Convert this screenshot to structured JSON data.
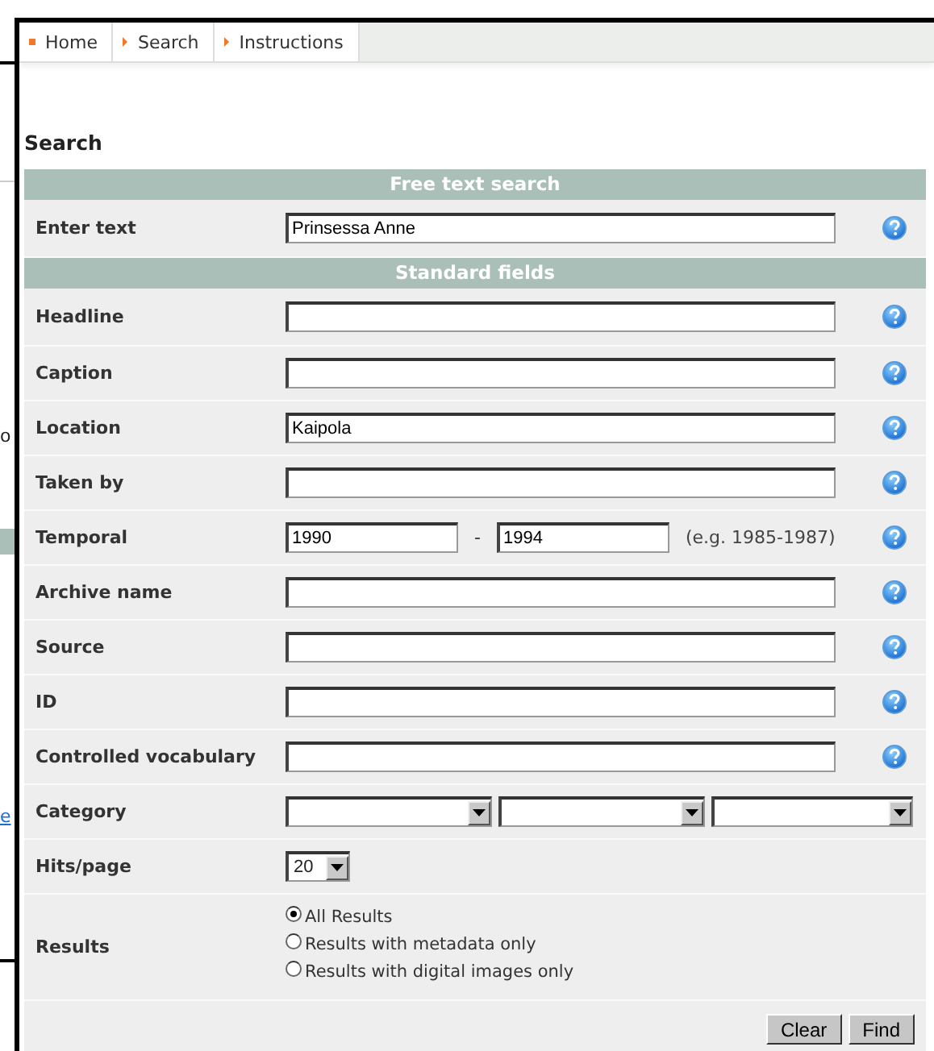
{
  "backdrop": {
    "fragment": "o",
    "link": "e"
  },
  "breadcrumb": [
    {
      "label": "Home",
      "kind": "home"
    },
    {
      "label": "Search",
      "kind": "step"
    },
    {
      "label": "Instructions",
      "kind": "step"
    }
  ],
  "title": "Search",
  "sections": [
    {
      "header": "Free text search",
      "rows": [
        {
          "label": "Enter text",
          "kind": "text",
          "value": "Prinsessa Anne"
        }
      ]
    },
    {
      "header": "Standard fields",
      "rows": [
        {
          "label": "Headline",
          "kind": "text",
          "value": ""
        },
        {
          "label": "Caption",
          "kind": "text",
          "value": ""
        },
        {
          "label": "Location",
          "kind": "text",
          "value": "Kaipola"
        },
        {
          "label": "Taken by",
          "kind": "text",
          "value": ""
        },
        {
          "label": "Temporal",
          "kind": "range",
          "from": "1990",
          "separator": "-",
          "to": "1994",
          "hint": "(e.g. 1985-1987)"
        },
        {
          "label": "Archive name",
          "kind": "text",
          "value": ""
        },
        {
          "label": "Source",
          "kind": "text",
          "value": ""
        },
        {
          "label": "ID",
          "kind": "text",
          "value": ""
        },
        {
          "label": "Controlled vocabulary",
          "kind": "text",
          "value": ""
        },
        {
          "label": "Category",
          "kind": "selects"
        },
        {
          "label": "Hits/page",
          "kind": "select",
          "value": "20"
        },
        {
          "label": "Results",
          "kind": "radios",
          "options": [
            {
              "label": "All Results",
              "selected": true
            },
            {
              "label": "Results with metadata only",
              "selected": false
            },
            {
              "label": "Results with digital images only",
              "selected": false
            }
          ]
        }
      ]
    }
  ],
  "buttons": [
    "Clear",
    "Find"
  ]
}
